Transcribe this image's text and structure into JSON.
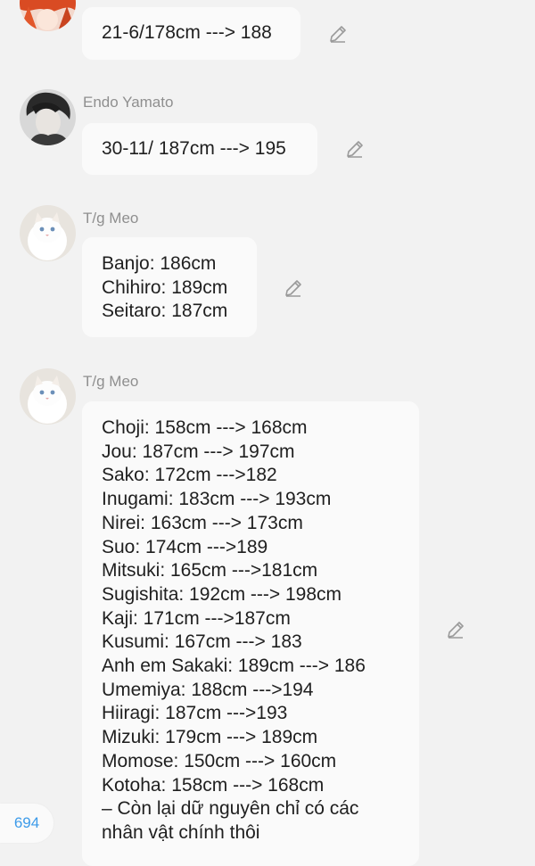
{
  "messages": [
    {
      "sender": "",
      "lines": [
        "21-6/178cm ---> 188"
      ]
    },
    {
      "sender": "Endo Yamato",
      "lines": [
        "30-11/ 187cm ---> 195"
      ]
    },
    {
      "sender": "T/g Meo",
      "lines": [
        "Banjo: 186cm",
        "Chihiro: 189cm",
        "Seitaro: 187cm"
      ]
    },
    {
      "sender": "T/g Meo",
      "lines": [
        "Choji: 158cm ---> 168cm",
        "Jou: 187cm ---> 197cm",
        "Sako: 172cm --->182",
        "Inugami: 183cm ---> 193cm",
        "Nirei: 163cm ---> 173cm",
        "Suo: 174cm --->189",
        "Mitsuki: 165cm --->181cm",
        "Sugishita: 192cm ---> 198cm",
        "Kaji: 171cm --->187cm",
        "Kusumi: 167cm ---> 183",
        "Anh em Sakaki: 189cm ---> 186",
        "Umemiya: 188cm --->194",
        "Hiiragi: 187cm --->193",
        "Mizuki: 179cm ---> 189cm",
        "Momose: 150cm ---> 160cm",
        "Kotoha: 158cm ---> 168cm",
        "– Còn lại dữ nguyên chỉ có các",
        "nhân vật chính thôi"
      ]
    }
  ],
  "reaction_count": "694",
  "icons": {
    "edit": "pencil-icon"
  }
}
